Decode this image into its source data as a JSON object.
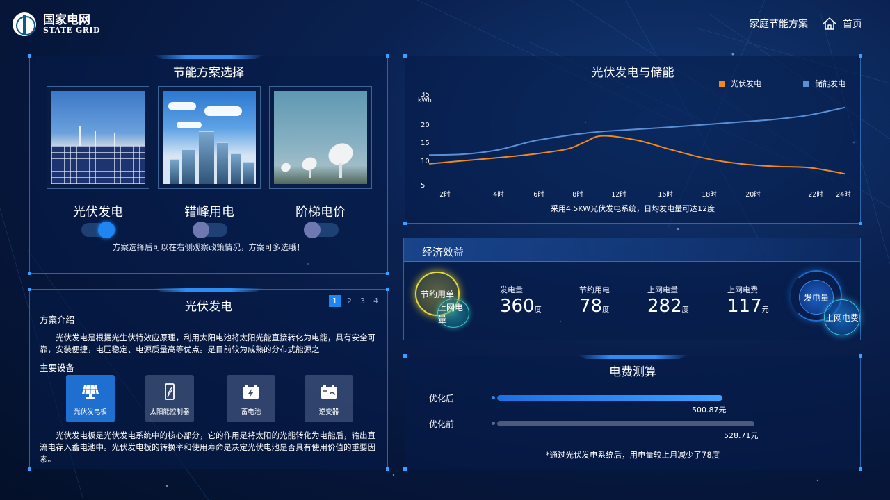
{
  "brand": {
    "name_cn": "国家电网",
    "name_en": "STATE GRID"
  },
  "nav": {
    "plan": "家庭节能方案",
    "home": "首页"
  },
  "scheme": {
    "title": "节能方案选择",
    "options": [
      {
        "label": "光伏发电",
        "on": true
      },
      {
        "label": "错峰用电",
        "on": false
      },
      {
        "label": "阶梯电价",
        "on": false
      }
    ],
    "hint": "方案选择后可以在右侧观察政策情况，方案可多选哦！"
  },
  "pv": {
    "title": "光伏发电",
    "pages": [
      "1",
      "2",
      "3",
      "4"
    ],
    "active_page": "1",
    "intro_label": "方案介绍",
    "intro_text": "光伏发电是根据光生伏特效应原理，利用太阳电池将太阳光能直接转化为电能，具有安全可靠，安装便捷，电压稳定、电源质量高等优点。是目前较为成熟的分布式能源之",
    "equip_label": "主要设备",
    "equipment": [
      {
        "label": "光伏发电板",
        "icon": "solar-panel-icon",
        "active": true
      },
      {
        "label": "太阳能控制器",
        "icon": "controller-icon",
        "active": false
      },
      {
        "label": "蓄电池",
        "icon": "battery-icon",
        "active": false
      },
      {
        "label": "逆变器",
        "icon": "inverter-icon",
        "active": false
      }
    ],
    "detail_text": "光伏发电板是光伏发电系统中的核心部分，它的作用是将太阳的光能转化为电能后，输出直流电存入蓄电池中。光伏发电板的转换率和使用寿命是决定光伏电池是否具有使用价值的重要因素。"
  },
  "chart": {
    "title": "光伏发电与储能",
    "note": "采用4.5KW光伏发电系统，日均发电量可达12度"
  },
  "chart_data": {
    "type": "line",
    "title": "光伏发电与储能",
    "ylabel": "kWh",
    "yticks": [
      5,
      10,
      15,
      20,
      35
    ],
    "x": [
      0,
      2,
      4,
      6,
      8,
      9,
      10,
      12,
      14,
      16,
      18,
      20,
      22,
      24
    ],
    "x_tick_labels": [
      "2时",
      "4时",
      "6时",
      "8时",
      "12时",
      "16时",
      "18时",
      "20时",
      "22时",
      "24时"
    ],
    "x_tick_values": [
      2,
      4,
      6,
      8,
      12,
      16,
      18,
      20,
      22,
      24
    ],
    "series": [
      {
        "name": "光伏发电",
        "color": "#f08a1e",
        "values": [
          9.8,
          10.5,
          11.2,
          12.0,
          13.2,
          14.8,
          16.2,
          15.2,
          13.0,
          11.0,
          9.8,
          9.2,
          8.9,
          7.5
        ]
      },
      {
        "name": "储能发电",
        "color": "#5b8fd6",
        "values": [
          11.8,
          12.0,
          13.0,
          15.0,
          16.3,
          16.8,
          17.2,
          17.7,
          18.2,
          18.8,
          19.4,
          20.0,
          21.0,
          22.7
        ]
      }
    ],
    "legend": "top-right",
    "grid": false
  },
  "econ": {
    "title": "经济效益",
    "bubbles": {
      "saving": "节约用单",
      "grid_power": "上网电量",
      "generation": "发电量",
      "grid_fee": "上网电费"
    },
    "metrics": [
      {
        "label": "发电量",
        "value": "360",
        "unit": "度"
      },
      {
        "label": "节约用电",
        "value": "78",
        "unit": "度"
      },
      {
        "label": "上网电量",
        "value": "282",
        "unit": "度"
      },
      {
        "label": "上网电费",
        "value": "117",
        "unit": "元"
      }
    ]
  },
  "cost": {
    "title": "电费测算",
    "after": {
      "label": "优化后",
      "value": "500.87元",
      "fraction": 0.875
    },
    "before": {
      "label": "优化前",
      "value": "528.71元",
      "fraction": 1.0
    },
    "note": "*通过光伏发电系统后，用电量较上月减少了78度"
  },
  "colors": {
    "accent": "#1e86f0",
    "orange": "#f08a1e",
    "blue_series": "#5b8fd6",
    "bar_after": "#2b8cf4",
    "bar_before": "#4a5a7a"
  }
}
